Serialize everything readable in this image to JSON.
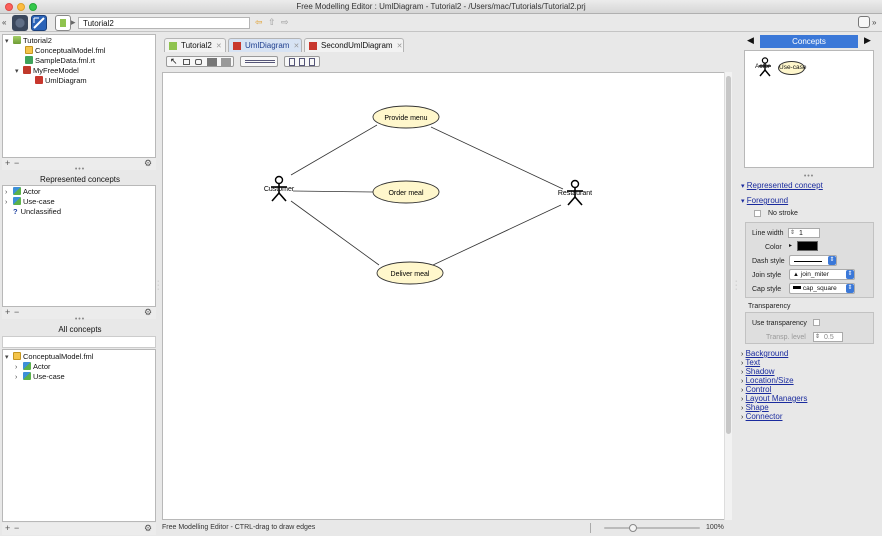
{
  "window": {
    "title": "Free Modelling Editor : UmlDiagram - Tutorial2 - /Users/mac/Tutorials/Tutorial2.prj"
  },
  "toolbar": {
    "path": "Tutorial2"
  },
  "project_tree": [
    {
      "label": "Tutorial2",
      "icon": "project-icon"
    },
    {
      "label": "ConceptualModel.fml",
      "icon": "fml-file-icon"
    },
    {
      "label": "SampleData.fml.rt",
      "icon": "data-file-icon"
    },
    {
      "label": "MyFreeModel",
      "icon": "free-model-icon"
    },
    {
      "label": "UmlDiagram",
      "icon": "diagram-icon"
    }
  ],
  "represented": {
    "title": "Represented concepts",
    "items": [
      "Actor",
      "Use-case",
      "Unclassified"
    ]
  },
  "all_concepts": {
    "title": "All concepts",
    "items": [
      "ConceptualModel.fml",
      "Actor",
      "Use-case"
    ]
  },
  "tabs": [
    {
      "label": "Tutorial2",
      "active": false
    },
    {
      "label": "UmlDiagram",
      "active": true
    },
    {
      "label": "SecondUmlDiagram",
      "active": false
    }
  ],
  "diagram": {
    "actors": [
      "Customer",
      "Restaurant"
    ],
    "usecases": [
      "Provide menu",
      "Order meal",
      "Deliver meal"
    ]
  },
  "status": {
    "message": "Free Modelling Editor - CTRL-drag to draw edges",
    "zoom": "100%",
    "zoom_fraction": 0.28
  },
  "inspector": {
    "panel_title": "Concepts",
    "palette": [
      "Actor",
      "Use-case"
    ],
    "sections": {
      "represented": "Represented concept",
      "foreground": "Foreground"
    },
    "no_stroke": "No stroke",
    "line_width_label": "Line width",
    "line_width": "1",
    "color_label": "Color",
    "dash_label": "Dash style",
    "join_label": "Join style",
    "join_value": "join_miter",
    "cap_label": "Cap style",
    "cap_value": "cap_square",
    "transparency_title": "Transparency",
    "use_transparency": "Use transparency",
    "transp_level_label": "Transp. level",
    "transp_level": "0.5",
    "collapsed": [
      "Background",
      "Text",
      "Shadow",
      "Location/Size",
      "Control",
      "Layout Managers",
      "Shape",
      "Connector"
    ]
  },
  "colors": {
    "accent": "#3b78d8",
    "usecase_fill": "#fff7cc",
    "link": "#1a2b9e"
  }
}
